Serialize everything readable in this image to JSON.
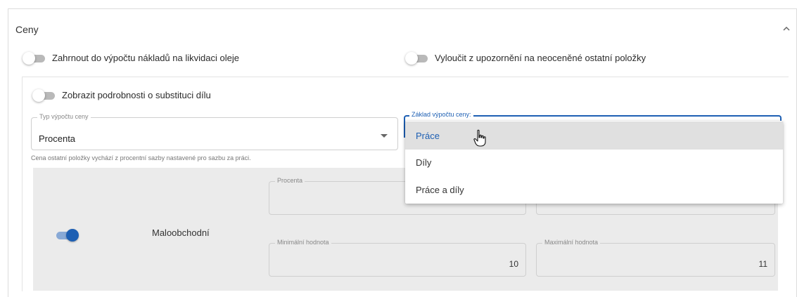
{
  "section": {
    "title": "Ceny"
  },
  "toggles": {
    "oil_disposal": {
      "label": "Zahrnout do výpočtu nákladů na likvidaci oleje",
      "on": false
    },
    "exclude_warnings": {
      "label": "Vyloučit z upozornění na neoceněné ostatní položky",
      "on": false
    },
    "substitution_details": {
      "label": "Zobrazit podrobnosti o substituci dílu",
      "on": false
    },
    "retail": {
      "label": "Maloobchodní",
      "on": true
    }
  },
  "price_calc_type": {
    "label": "Typ výpočtu ceny",
    "value": "Procenta",
    "helper": "Cena ostatní položky vychází z procentní sazby nastavené pro sazbu za práci."
  },
  "price_calc_base": {
    "label": "Základ výpočtu ceny:",
    "options": [
      "Práce",
      "Díly",
      "Práce a díly"
    ],
    "highlighted": "Práce"
  },
  "retail_fields": {
    "percent_label": "Procenta",
    "min_label": "Minimální hodnota",
    "min_value": "10",
    "max_label": "Maximální hodnota",
    "max_value": "11"
  },
  "colors": {
    "accent": "#1d5fb3",
    "panel": "#ebebeb",
    "hover": "#e0e0e0"
  },
  "icons": {
    "collapse": "chevron-up-icon",
    "dropdown": "caret-down-icon",
    "cursor": "hand-pointer-icon"
  }
}
